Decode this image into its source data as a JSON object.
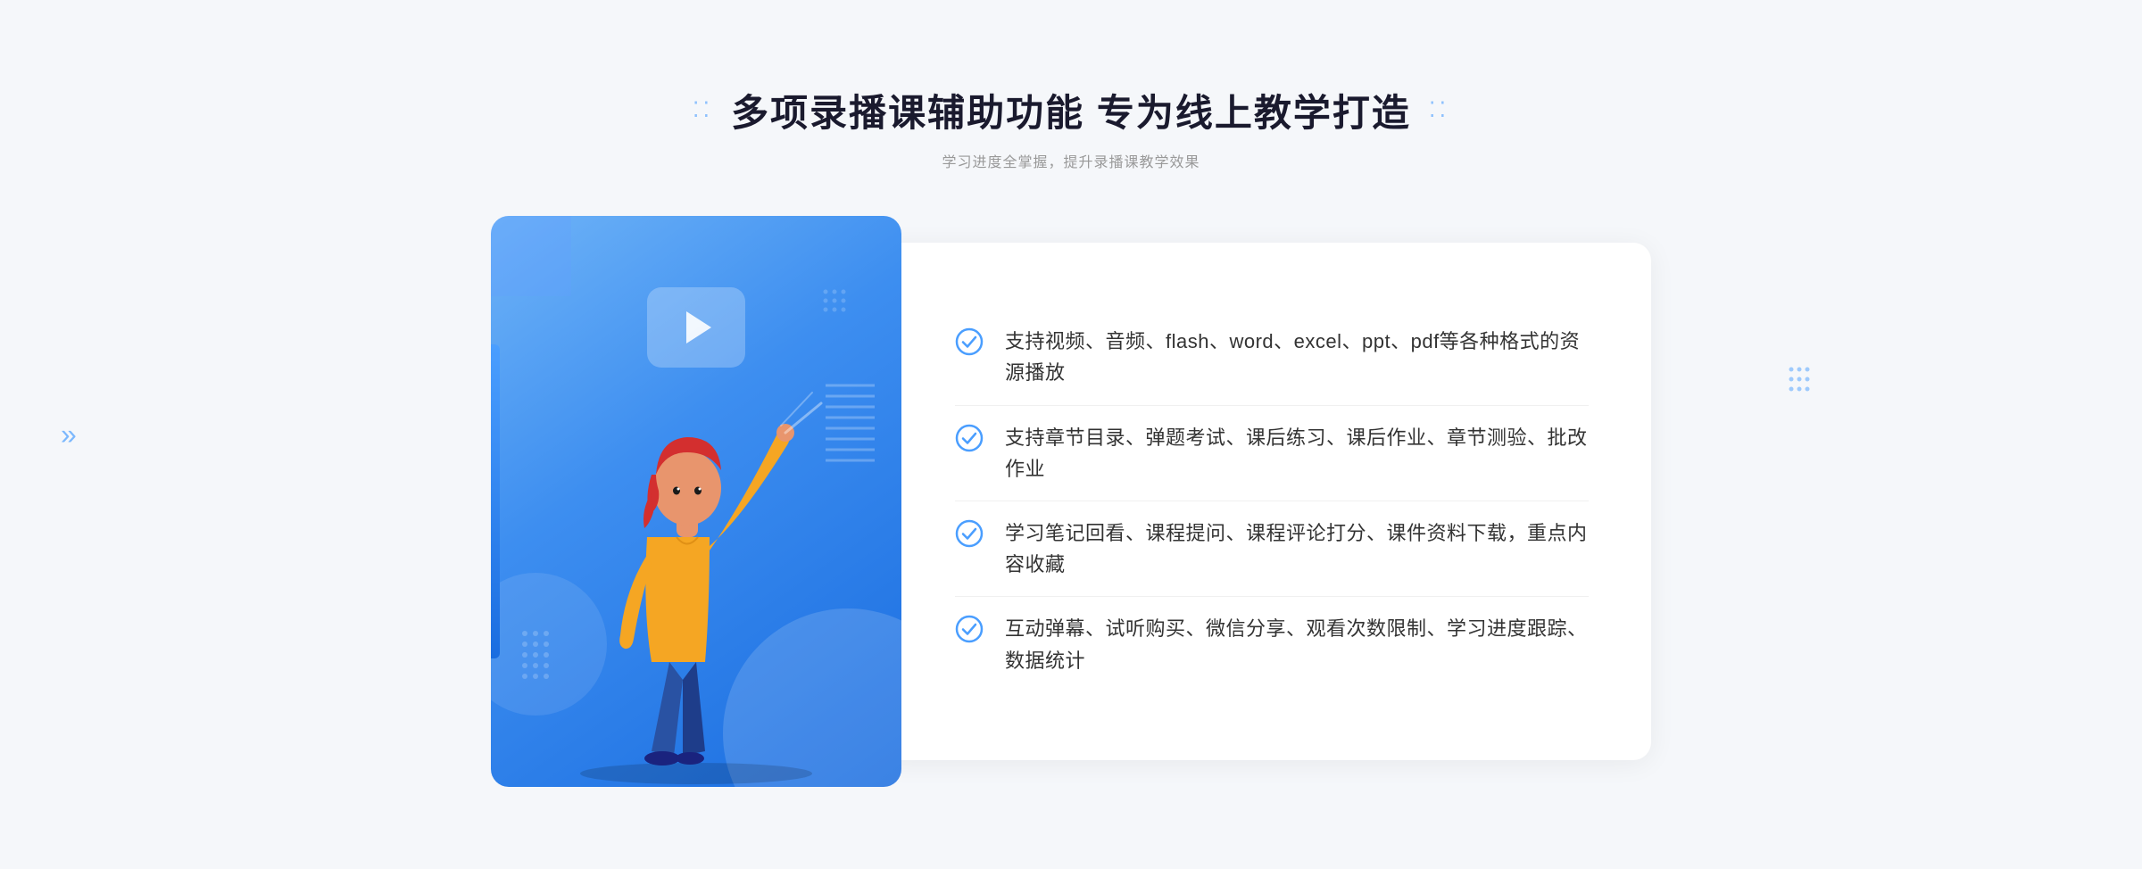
{
  "header": {
    "title": "多项录播课辅助功能 专为线上教学打造",
    "subtitle": "学习进度全掌握，提升录播课教学效果",
    "title_dots_left": "⁚⁚",
    "title_dots_right": "⁚⁚"
  },
  "features": [
    {
      "id": 1,
      "text": "支持视频、音频、flash、word、excel、ppt、pdf等各种格式的资源播放"
    },
    {
      "id": 2,
      "text": "支持章节目录、弹题考试、课后练习、课后作业、章节测验、批改作业"
    },
    {
      "id": 3,
      "text": "学习笔记回看、课程提问、课程评论打分、课件资料下载，重点内容收藏"
    },
    {
      "id": 4,
      "text": "互动弹幕、试听购买、微信分享、观看次数限制、学习进度跟踪、数据统计"
    }
  ],
  "colors": {
    "primary_blue": "#1a6de0",
    "light_blue": "#4a9eff",
    "title_color": "#1a1a2e",
    "text_color": "#333333",
    "subtitle_color": "#999999"
  },
  "chevron_symbol": "»"
}
